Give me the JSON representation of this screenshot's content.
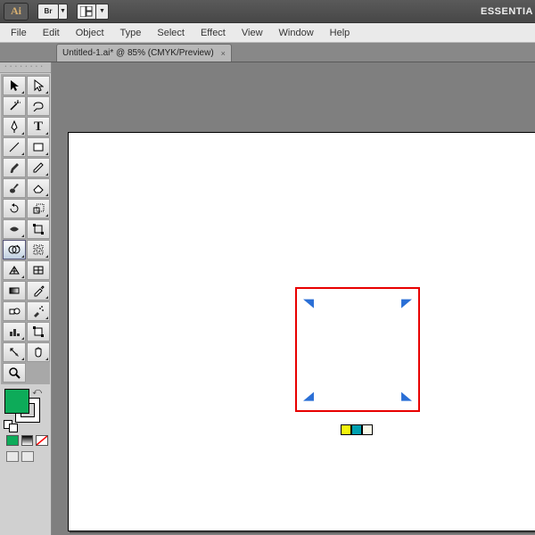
{
  "topbar": {
    "logo": "Ai",
    "bridge": "Br",
    "workspace": "ESSENTIA"
  },
  "menu": {
    "file": "File",
    "edit": "Edit",
    "object": "Object",
    "type": "Type",
    "select": "Select",
    "effect": "Effect",
    "view": "View",
    "window": "Window",
    "help": "Help"
  },
  "tab": {
    "title": "Untitled-1.ai* @ 85% (CMYK/Preview)",
    "close": "×"
  },
  "tools": {
    "selection": "selection",
    "direct_select": "direct-select",
    "magic_wand": "magic-wand",
    "lasso": "lasso",
    "pen": "pen",
    "type": "type",
    "line": "line",
    "rectangle": "rectangle",
    "paintbrush": "paintbrush",
    "pencil": "pencil",
    "blob": "blob-brush",
    "eraser": "eraser",
    "rotate": "rotate",
    "scale": "scale",
    "width": "width",
    "free_transform": "free-transform",
    "shape_builder": "shape-builder",
    "live_paint": "live-paint",
    "perspective": "perspective-grid",
    "mesh": "mesh",
    "gradient": "gradient",
    "eyedropper": "eyedropper",
    "blend": "blend",
    "symbol_sprayer": "symbol-sprayer",
    "column_graph": "column-graph",
    "artboard": "artboard",
    "slice": "slice",
    "hand": "hand",
    "zoom": "zoom"
  },
  "colors": {
    "fill": "#0dab59",
    "stroke": "#000000",
    "highlight_box": "#e80000"
  }
}
